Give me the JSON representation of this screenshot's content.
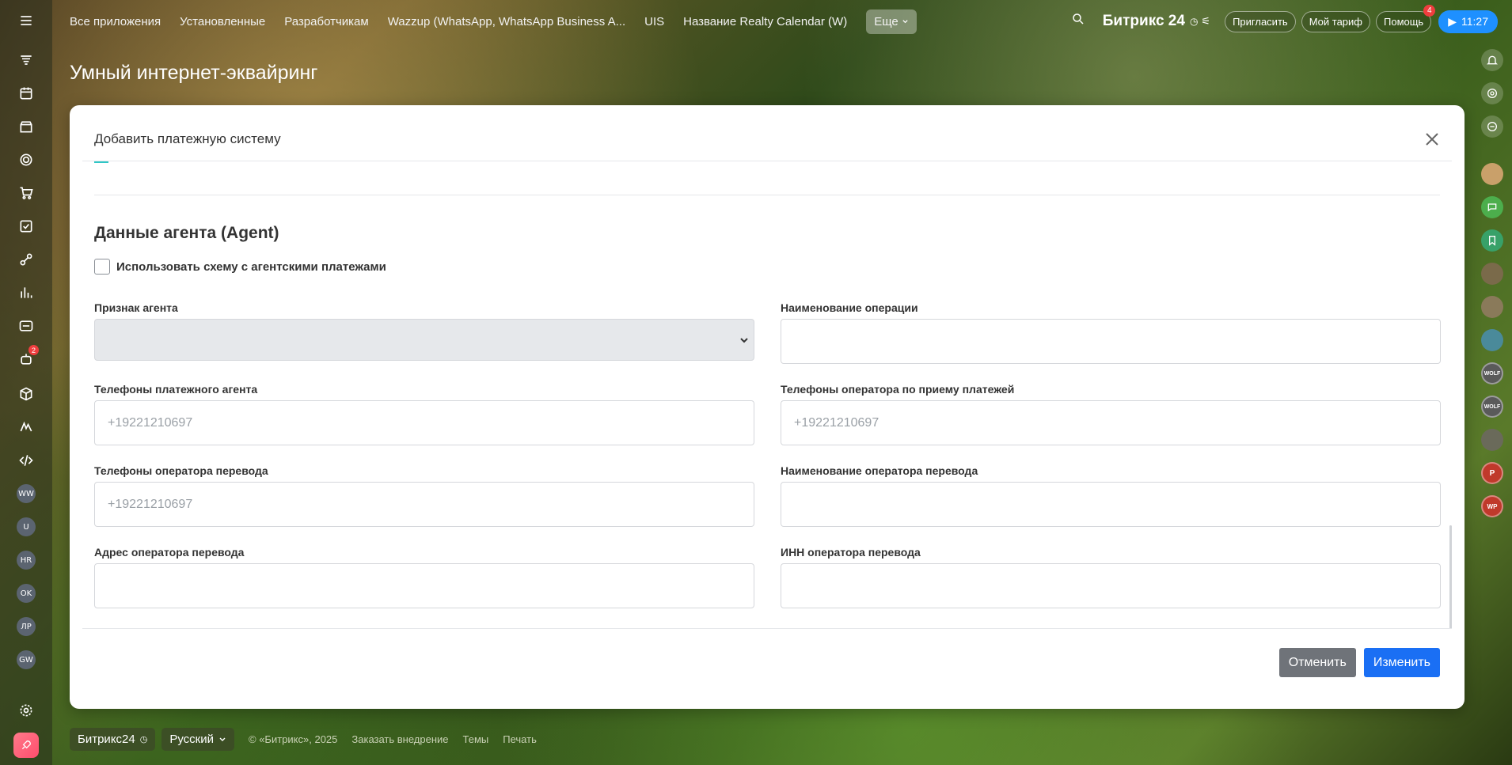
{
  "top_nav": {
    "items": [
      "Все приложения",
      "Установленные",
      "Разработчикам",
      "Wazzup (WhatsApp, WhatsApp Business A...",
      "UIS",
      "Название Realty Calendar (W)"
    ],
    "more_label": "Еще"
  },
  "top_right": {
    "brand": "Битрикс 24",
    "invite": "Пригласить",
    "tariff": "Мой тариф",
    "help": "Помощь",
    "help_badge": "4",
    "time": "11:27"
  },
  "left_bar": {
    "badge_count": "2",
    "avatars": [
      "WW",
      "U",
      "HR",
      "OK",
      "ЛР",
      "GW"
    ]
  },
  "right_bar": {
    "avatars": [
      "WOLF",
      "WOLF",
      "P",
      "WP"
    ]
  },
  "page": {
    "title": "Умный интернет-эквайринг"
  },
  "modal": {
    "title": "Добавить платежную систему",
    "section_title": "Данные агента (Agent)",
    "checkbox_label": "Использовать схему с агентскими платежами",
    "fields": {
      "agent_sign": {
        "label": "Признак агента",
        "value": ""
      },
      "operation_name": {
        "label": "Наименование операции",
        "value": ""
      },
      "agent_phones": {
        "label": "Телефоны платежного агента",
        "placeholder": "+19221210697"
      },
      "receiver_phones": {
        "label": "Телефоны оператора по приему платежей",
        "placeholder": "+19221210697"
      },
      "transfer_phones": {
        "label": "Телефоны оператора перевода",
        "placeholder": "+19221210697"
      },
      "transfer_name": {
        "label": "Наименование оператора перевода",
        "value": ""
      },
      "transfer_address": {
        "label": "Адрес оператора перевода",
        "value": ""
      },
      "transfer_inn": {
        "label": "ИНН оператора перевода",
        "value": ""
      }
    },
    "cancel_label": "Отменить",
    "apply_label": "Изменить"
  },
  "footer": {
    "brand": "Битрикс24",
    "language": "Русский",
    "copyright": "© «Битрикс», 2025",
    "order": "Заказать внедрение",
    "themes": "Темы",
    "print": "Печать"
  }
}
